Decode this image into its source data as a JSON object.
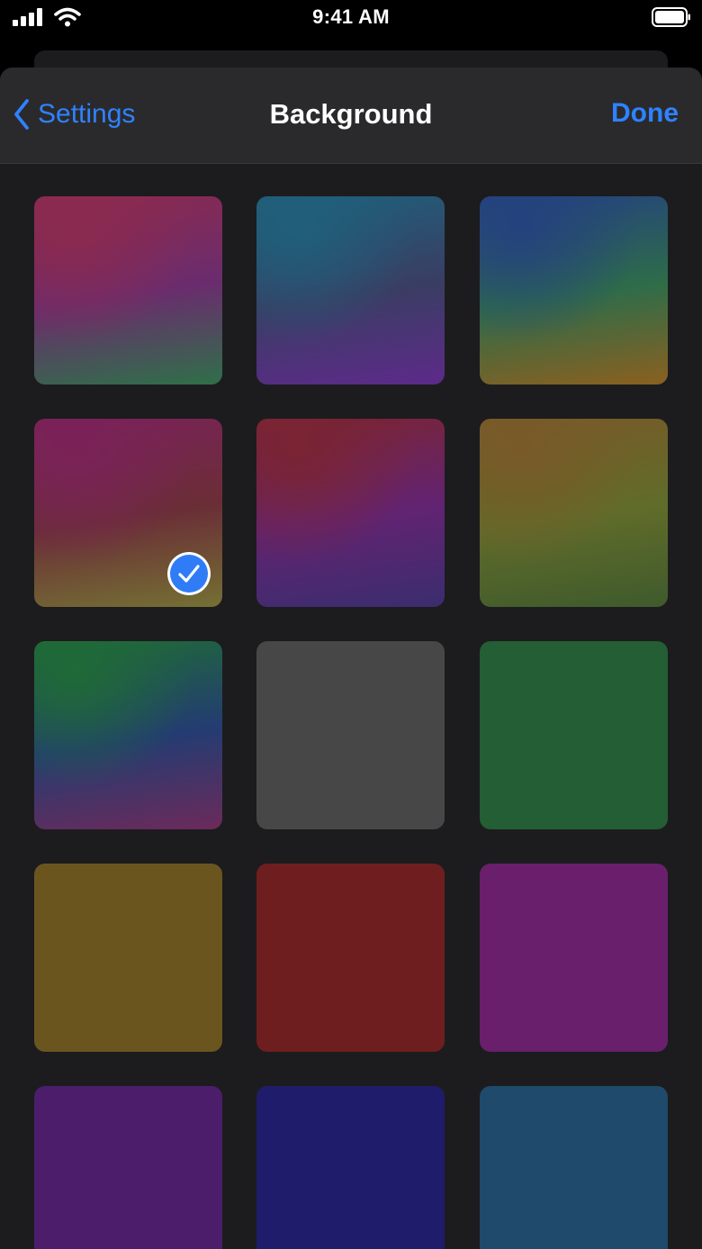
{
  "status_bar": {
    "time": "9:41 AM",
    "signal_icon": "cellular-signal-icon",
    "wifi_icon": "wifi-icon",
    "battery_icon": "battery-icon"
  },
  "nav": {
    "back_label": "Settings",
    "back_icon": "chevron-left-icon",
    "title": "Background",
    "done_label": "Done",
    "accent_color": "#2f82ff"
  },
  "backgrounds": [
    {
      "id": "gradient-1",
      "style": "gradient",
      "colors": [
        "#8b2a4f",
        "#6a2c6e",
        "#2f6f49"
      ],
      "selected": false
    },
    {
      "id": "gradient-2",
      "style": "gradient",
      "colors": [
        "#1f5f7a",
        "#3a3d63",
        "#5d2a8a"
      ],
      "selected": false
    },
    {
      "id": "gradient-3",
      "style": "gradient",
      "colors": [
        "#24427e",
        "#2e6c49",
        "#8a6020"
      ],
      "selected": false
    },
    {
      "id": "gradient-4",
      "style": "gradient",
      "colors": [
        "#7a2258",
        "#6a2e36",
        "#747034"
      ],
      "selected": true
    },
    {
      "id": "gradient-5",
      "style": "gradient",
      "colors": [
        "#7a2433",
        "#622372",
        "#3b2d6e"
      ],
      "selected": false
    },
    {
      "id": "gradient-6",
      "style": "gradient",
      "colors": [
        "#785a28",
        "#606c2a",
        "#3f5a2c"
      ],
      "selected": false
    },
    {
      "id": "gradient-7",
      "style": "gradient",
      "colors": [
        "#1f6a37",
        "#233c72",
        "#6b2a5a"
      ],
      "selected": false
    },
    {
      "id": "solid-gray",
      "style": "solid",
      "colors": [
        "#474747"
      ],
      "selected": false
    },
    {
      "id": "solid-green",
      "style": "solid",
      "colors": [
        "#235e34"
      ],
      "selected": false
    },
    {
      "id": "solid-ochre",
      "style": "solid",
      "colors": [
        "#6b551f"
      ],
      "selected": false
    },
    {
      "id": "solid-red",
      "style": "solid",
      "colors": [
        "#6f1e1f"
      ],
      "selected": false
    },
    {
      "id": "solid-magenta",
      "style": "solid",
      "colors": [
        "#691f6c"
      ],
      "selected": false
    },
    {
      "id": "solid-purple",
      "style": "solid",
      "colors": [
        "#4b1d6b"
      ],
      "selected": false
    },
    {
      "id": "solid-indigo",
      "style": "solid",
      "colors": [
        "#1f1c6b"
      ],
      "selected": false
    },
    {
      "id": "solid-teal",
      "style": "solid",
      "colors": [
        "#1f4a6b"
      ],
      "selected": false
    }
  ],
  "selection_icon": "checkmark-circle-icon"
}
